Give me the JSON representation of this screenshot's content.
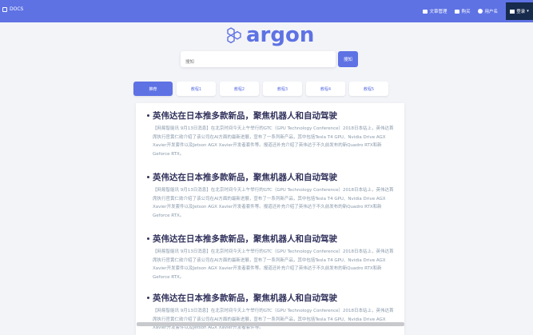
{
  "header": {
    "docs_label": "DOCS",
    "nav": [
      {
        "label": "文章管理",
        "icon": "folder-icon"
      },
      {
        "label": "购买",
        "icon": "cart-icon"
      },
      {
        "label": "用户名",
        "icon": "user-icon"
      }
    ],
    "login_label": "登录",
    "bg_color": "#5e72e4"
  },
  "logo": {
    "text": "argon",
    "icon": "hexagon-cluster-icon",
    "color": "#5e72e4"
  },
  "search": {
    "placeholder": "搜知",
    "button_label": "搜知"
  },
  "tabs": [
    {
      "label": "推荐",
      "active": true
    },
    {
      "label": "教程1",
      "active": false
    },
    {
      "label": "教程2",
      "active": false
    },
    {
      "label": "教程3",
      "active": false
    },
    {
      "label": "教程4",
      "active": false
    },
    {
      "label": "教程5",
      "active": false
    }
  ],
  "articles": [
    {
      "title": "英伟达在日本推多款新品，聚焦机器人和自动驾驶",
      "summary": "【网易智能讯 9月13日消息】在北京时间今天上午举行的GTC（GPU Technology Conference）2018日本站上，英伟达首席执行官黄仁勋介绍了该公司在AI方面的最新进展，宣布了一系列新产品，其中包括Tesla T4 GPU、Nvidia Drive AGX Xavier开发套件以及Jetson AGX Xavier开发者套件等。报道还补充介绍了英伟达于不久前发布的新Quadro RTX和新Geforce RTX。"
    },
    {
      "title": "英伟达在日本推多款新品，聚焦机器人和自动驾驶",
      "summary": "【网易智能讯 9月13日消息】在北京时间今天上午举行的GTC（GPU Technology Conference）2018日本站上，英伟达首席执行官黄仁勋介绍了该公司在AI方面的最新进展，宣布了一系列新产品，其中包括Tesla T4 GPU、Nvidia Drive AGX Xavier开发套件以及Jetson AGX Xavier开发者套件等。报道还补充介绍了英伟达于不久前发布的新Quadro RTX和新Geforce RTX。"
    },
    {
      "title": "英伟达在日本推多款新品，聚焦机器人和自动驾驶",
      "summary": "【网易智能讯 9月13日消息】在北京时间今天上午举行的GTC（GPU Technology Conference）2018日本站上，英伟达首席执行官黄仁勋介绍了该公司在AI方面的最新进展，宣布了一系列新产品，其中包括Tesla T4 GPU、Nvidia Drive AGX Xavier开发套件以及Jetson AGX Xavier开发者套件等。报道还补充介绍了英伟达于不久前发布的新Quadro RTX和新Geforce RTX。"
    },
    {
      "title": "英伟达在日本推多款新品，聚焦机器人和自动驾驶",
      "summary": "【网易智能讯 9月13日消息】在北京时间今天上午举行的GTC（GPU Technology Conference）2018日本站上，英伟达首席执行官黄仁勋介绍了该公司在AI方面的最新进展，宣布了一系列新产品，其中包括Tesla T4 GPU、Nvidia Drive AGX Xavier开发套件以及Jetson AGX Xavier开发者套件等。"
    }
  ]
}
